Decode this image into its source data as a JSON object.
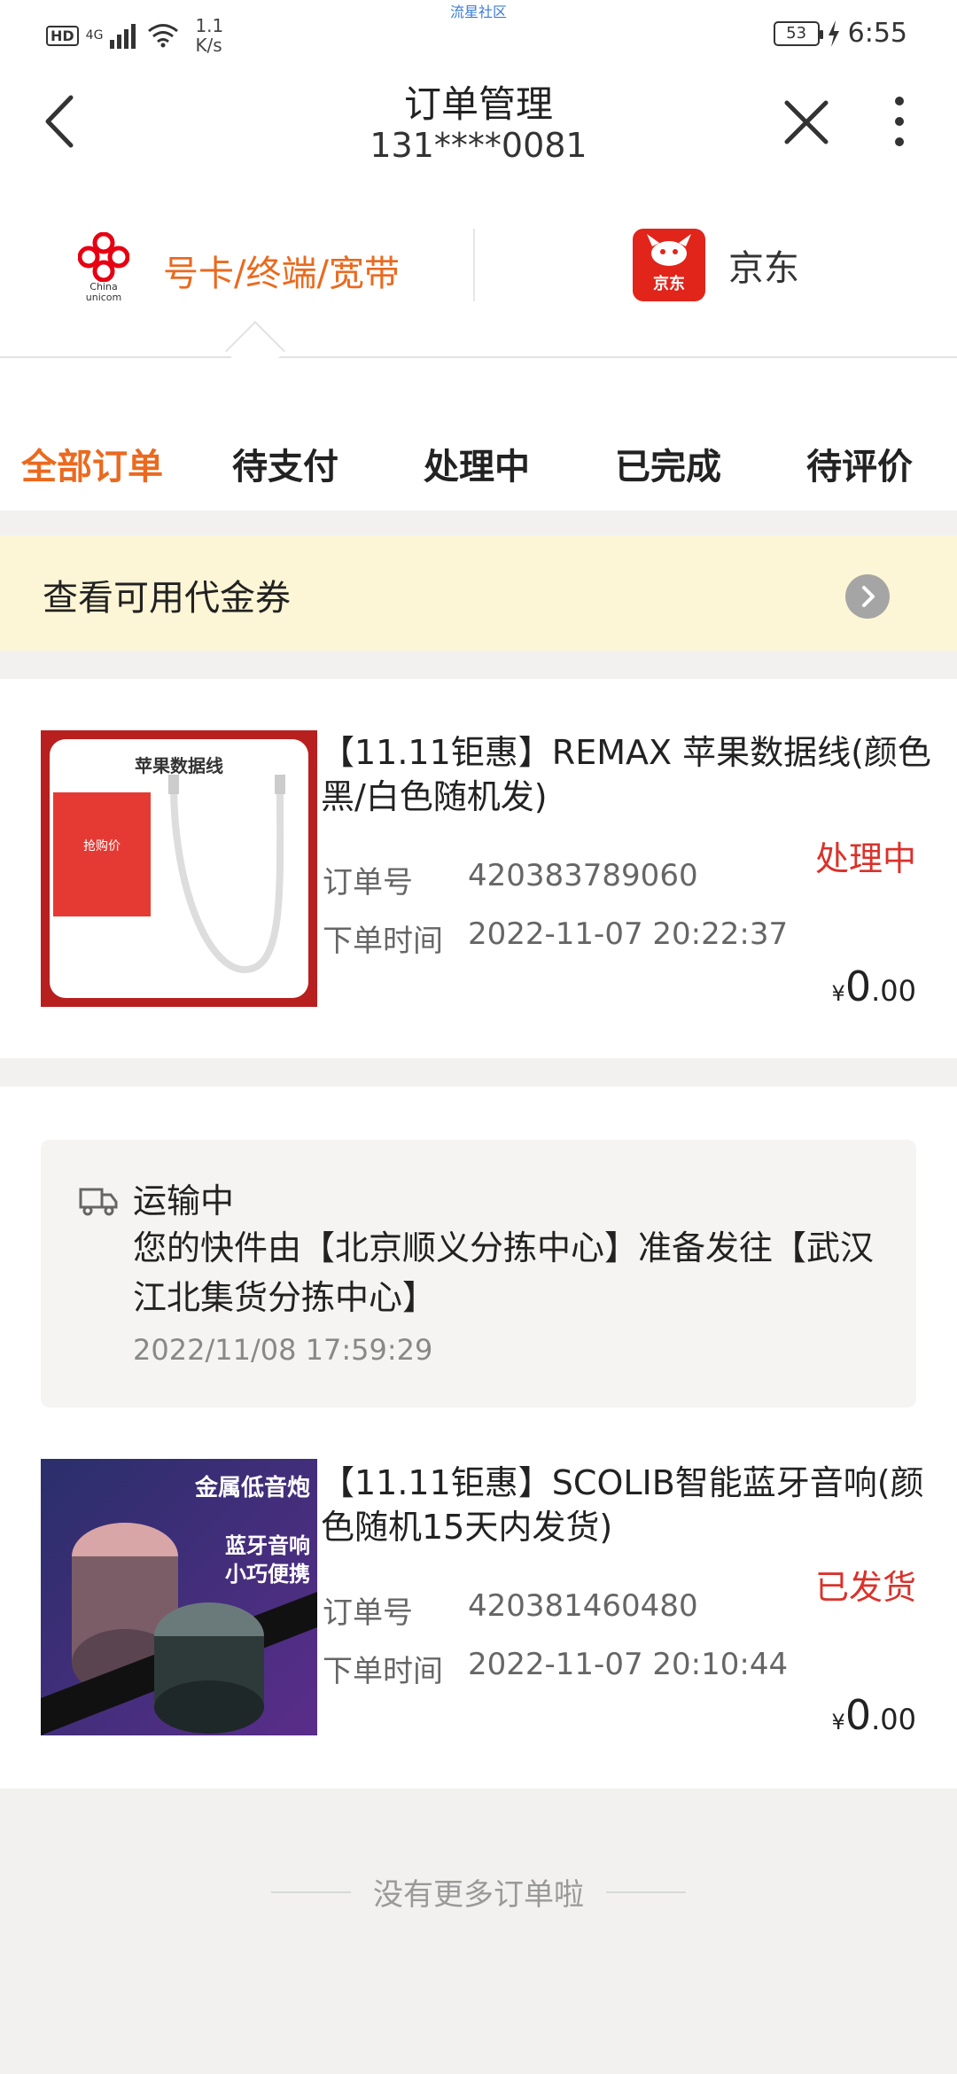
{
  "status_bar": {
    "hd": "HD",
    "net": "4G",
    "speed_value": "1.1",
    "speed_unit": "K/s",
    "center_text": "流星社区",
    "battery": "53",
    "time": "6:55"
  },
  "header": {
    "title": "订单管理",
    "subtitle": "131****0081"
  },
  "platforms": {
    "unicom_logo_text": "China unicom",
    "unicom_label": "号卡/终端/宽带",
    "jd_logo_text": "京东",
    "jd_label": "京东"
  },
  "tabs": [
    "全部订单",
    "待支付",
    "处理中",
    "已完成",
    "待评价"
  ],
  "coupon": {
    "label": "查看可用代金券"
  },
  "orders": [
    {
      "title": "【11.11钜惠】REMAX 苹果数据线(颜色黑/白色随机发)",
      "thumb_label": "苹果数据线",
      "thumb_badge": "抢购价",
      "status": "处理中",
      "order_label": "订单号",
      "order_no": "420383789060",
      "time_label": "下单时间",
      "time": "2022-11-07 20:22:37",
      "currency": "¥",
      "price_int": "0",
      "price_dec": ".00"
    },
    {
      "title": "【11.11钜惠】SCOLIB智能蓝牙音响(颜色随机15天内发货)",
      "thumb_line1": "金属低音炮",
      "thumb_line2": "蓝牙音响",
      "thumb_line3": "小巧便携",
      "status": "已发货",
      "order_label": "订单号",
      "order_no": "420381460480",
      "time_label": "下单时间",
      "time": "2022-11-07 20:10:44",
      "currency": "¥",
      "price_int": "0",
      "price_dec": ".00"
    }
  ],
  "tracking": {
    "status": "运输中",
    "message": "您的快件由【北京顺义分拣中心】准备发往【武汉江北集货分拣中心】",
    "time": "2022/11/08 17:59:29"
  },
  "footer": {
    "text": "没有更多订单啦"
  },
  "colors": {
    "accent_orange": "#ea6a1f",
    "status_red": "#d9322b",
    "coupon_bg": "#fdf6d6",
    "jd_red": "#e1251b",
    "page_bg": "#f3f1ef"
  }
}
